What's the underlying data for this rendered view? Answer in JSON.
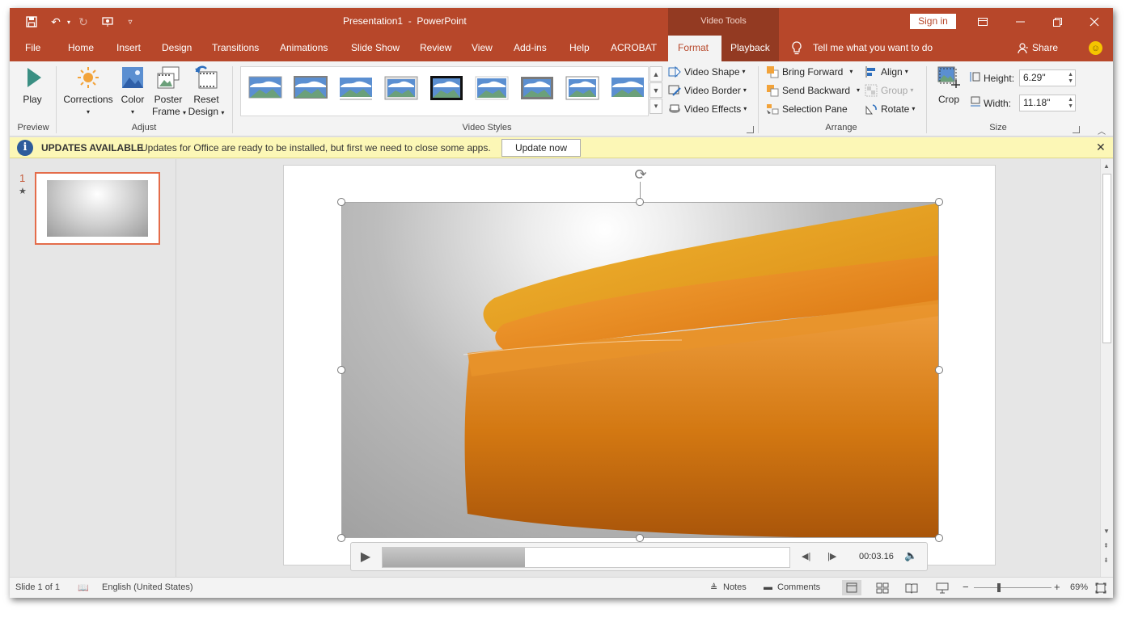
{
  "app": {
    "doc_title": "Presentation1  -  PowerPoint",
    "contextual_tab_group": "Video Tools",
    "sign_in": "Sign in",
    "share": "Share",
    "tell_me": "Tell me what you want to do"
  },
  "tabs": [
    "File",
    "Home",
    "Insert",
    "Design",
    "Transitions",
    "Animations",
    "Slide Show",
    "Review",
    "View",
    "Add-ins",
    "Help",
    "ACROBAT",
    "Format",
    "Playback"
  ],
  "active_tab": "Format",
  "ribbon": {
    "preview": {
      "play": "Play",
      "group": "Preview"
    },
    "adjust": {
      "corrections": "Corrections",
      "color": "Color",
      "poster": "Poster",
      "frame": "Frame",
      "reset": "Reset",
      "design": "Design",
      "group": "Adjust"
    },
    "video_styles": {
      "video_shape": "Video Shape",
      "video_border": "Video Border",
      "video_effects": "Video Effects",
      "group": "Video Styles"
    },
    "arrange": {
      "bring_forward": "Bring Forward",
      "send_backward": "Send Backward",
      "selection_pane": "Selection Pane",
      "align": "Align",
      "group_btn": "Group",
      "rotate": "Rotate",
      "group": "Arrange"
    },
    "size": {
      "crop": "Crop",
      "height_label": "Height:",
      "height_value": "6.29\"",
      "width_label": "Width:",
      "width_value": "11.18\"",
      "group": "Size"
    }
  },
  "update_bar": {
    "title": "UPDATES AVAILABLE",
    "message": "Updates for Office are ready to be installed, but first we need to close some apps.",
    "button": "Update now"
  },
  "thumbnails": {
    "slide_number": "1",
    "transition_marker": "★"
  },
  "player": {
    "timecode": "00:03.16",
    "progress": 0.35
  },
  "status": {
    "slide_info": "Slide 1 of 1",
    "language": "English (United States)",
    "notes": "Notes",
    "comments": "Comments",
    "zoom": "69%",
    "zoom_level": 0.69
  },
  "colors": {
    "accent": "#b7472a",
    "accent_dark": "#933a22",
    "ribbon_bg": "#f3f3f3",
    "update_bar": "#fcf7b6"
  },
  "icons": [
    "save-icon",
    "undo-icon",
    "redo-icon",
    "presenter-icon",
    "customize-qat-icon",
    "ribbon-display-icon",
    "minimize-icon",
    "restore-icon",
    "close-icon",
    "lightbulb-icon",
    "share-person-icon",
    "smiley-icon"
  ]
}
